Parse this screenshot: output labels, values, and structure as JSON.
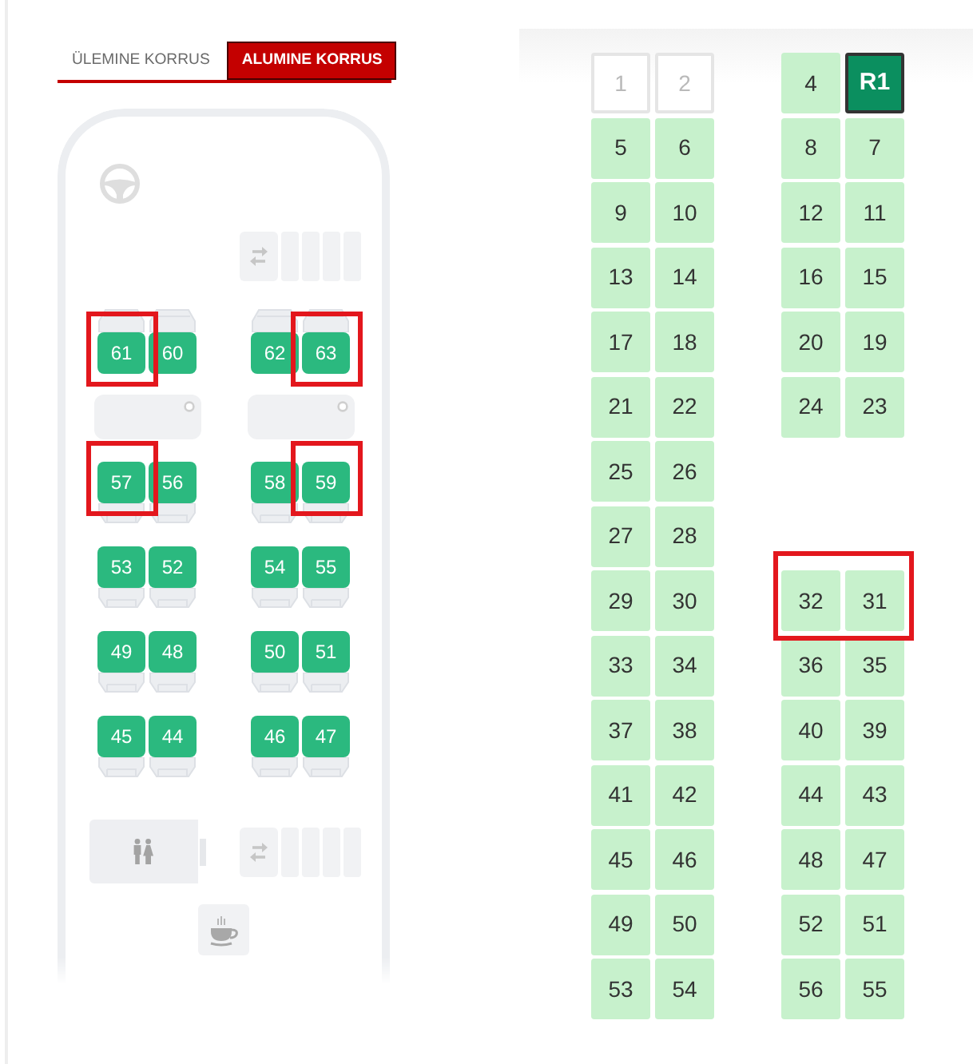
{
  "floor_tabs": [
    {
      "label": "ÜLEMINE KORRUS",
      "selected": false
    },
    {
      "label": "ALUMINE KORRUS",
      "selected": true
    }
  ],
  "bus_layout": [
    {
      "kind": "driver"
    },
    {
      "kind": "stairs"
    },
    {
      "kind": "seats",
      "back_above": true,
      "left": [
        {
          "label": "61",
          "highlighted": true
        },
        {
          "label": "60",
          "highlighted": false
        }
      ],
      "right": [
        {
          "label": "62",
          "highlighted": false
        },
        {
          "label": "63",
          "highlighted": true
        }
      ]
    },
    {
      "kind": "tables"
    },
    {
      "kind": "seats",
      "back_above": false,
      "left": [
        {
          "label": "57",
          "highlighted": true
        },
        {
          "label": "56",
          "highlighted": false
        }
      ],
      "right": [
        {
          "label": "58",
          "highlighted": false
        },
        {
          "label": "59",
          "highlighted": true
        }
      ]
    },
    {
      "kind": "seats",
      "back_above": false,
      "left": [
        {
          "label": "53",
          "highlighted": false
        },
        {
          "label": "52",
          "highlighted": false
        }
      ],
      "right": [
        {
          "label": "54",
          "highlighted": false
        },
        {
          "label": "55",
          "highlighted": false
        }
      ]
    },
    {
      "kind": "seats",
      "back_above": false,
      "left": [
        {
          "label": "49",
          "highlighted": false
        },
        {
          "label": "48",
          "highlighted": false
        }
      ],
      "right": [
        {
          "label": "50",
          "highlighted": false
        },
        {
          "label": "51",
          "highlighted": false
        }
      ]
    },
    {
      "kind": "seats",
      "back_above": false,
      "left": [
        {
          "label": "45",
          "highlighted": false
        },
        {
          "label": "44",
          "highlighted": false
        }
      ],
      "right": [
        {
          "label": "46",
          "highlighted": false
        },
        {
          "label": "47",
          "highlighted": false
        }
      ]
    },
    {
      "kind": "restroom_stairs"
    },
    {
      "kind": "cafe"
    }
  ],
  "seat_grid": {
    "rows": [
      {
        "left": {
          "highlighted": false,
          "seats": [
            {
              "label": "1",
              "available": false,
              "selected": false
            },
            {
              "label": "2",
              "available": false,
              "selected": false
            }
          ]
        },
        "right": {
          "highlighted": false,
          "seats": [
            {
              "label": "4",
              "available": true,
              "selected": false
            },
            {
              "label": "R1",
              "available": true,
              "selected": true
            }
          ]
        }
      },
      {
        "left": {
          "highlighted": false,
          "seats": [
            {
              "label": "5",
              "available": true,
              "selected": false
            },
            {
              "label": "6",
              "available": true,
              "selected": false
            }
          ]
        },
        "right": {
          "highlighted": false,
          "seats": [
            {
              "label": "8",
              "available": true,
              "selected": false
            },
            {
              "label": "7",
              "available": true,
              "selected": false
            }
          ]
        }
      },
      {
        "left": {
          "highlighted": false,
          "seats": [
            {
              "label": "9",
              "available": true,
              "selected": false
            },
            {
              "label": "10",
              "available": true,
              "selected": false
            }
          ]
        },
        "right": {
          "highlighted": false,
          "seats": [
            {
              "label": "12",
              "available": true,
              "selected": false
            },
            {
              "label": "11",
              "available": true,
              "selected": false
            }
          ]
        }
      },
      {
        "left": {
          "highlighted": false,
          "seats": [
            {
              "label": "13",
              "available": true,
              "selected": false
            },
            {
              "label": "14",
              "available": true,
              "selected": false
            }
          ]
        },
        "right": {
          "highlighted": false,
          "seats": [
            {
              "label": "16",
              "available": true,
              "selected": false
            },
            {
              "label": "15",
              "available": true,
              "selected": false
            }
          ]
        }
      },
      {
        "left": {
          "highlighted": false,
          "seats": [
            {
              "label": "17",
              "available": true,
              "selected": false
            },
            {
              "label": "18",
              "available": true,
              "selected": false
            }
          ]
        },
        "right": {
          "highlighted": false,
          "seats": [
            {
              "label": "20",
              "available": true,
              "selected": false
            },
            {
              "label": "19",
              "available": true,
              "selected": false
            }
          ]
        }
      },
      {
        "left": {
          "highlighted": false,
          "seats": [
            {
              "label": "21",
              "available": true,
              "selected": false
            },
            {
              "label": "22",
              "available": true,
              "selected": false
            }
          ]
        },
        "right": {
          "highlighted": false,
          "seats": [
            {
              "label": "24",
              "available": true,
              "selected": false
            },
            {
              "label": "23",
              "available": true,
              "selected": false
            }
          ]
        }
      },
      {
        "left": {
          "highlighted": false,
          "seats": [
            {
              "label": "25",
              "available": true,
              "selected": false
            },
            {
              "label": "26",
              "available": true,
              "selected": false
            }
          ]
        }
      },
      {
        "left": {
          "highlighted": false,
          "seats": [
            {
              "label": "27",
              "available": true,
              "selected": false
            },
            {
              "label": "28",
              "available": true,
              "selected": false
            }
          ]
        }
      },
      {
        "left": {
          "highlighted": false,
          "seats": [
            {
              "label": "29",
              "available": true,
              "selected": false
            },
            {
              "label": "30",
              "available": true,
              "selected": false
            }
          ]
        },
        "right": {
          "highlighted": true,
          "seats": [
            {
              "label": "32",
              "available": true,
              "selected": false
            },
            {
              "label": "31",
              "available": true,
              "selected": false
            }
          ]
        }
      },
      {
        "left": {
          "highlighted": false,
          "seats": [
            {
              "label": "33",
              "available": true,
              "selected": false
            },
            {
              "label": "34",
              "available": true,
              "selected": false
            }
          ]
        },
        "right": {
          "highlighted": false,
          "seats": [
            {
              "label": "36",
              "available": true,
              "selected": false
            },
            {
              "label": "35",
              "available": true,
              "selected": false
            }
          ]
        }
      },
      {
        "left": {
          "highlighted": false,
          "seats": [
            {
              "label": "37",
              "available": true,
              "selected": false
            },
            {
              "label": "38",
              "available": true,
              "selected": false
            }
          ]
        },
        "right": {
          "highlighted": false,
          "seats": [
            {
              "label": "40",
              "available": true,
              "selected": false
            },
            {
              "label": "39",
              "available": true,
              "selected": false
            }
          ]
        }
      },
      {
        "left": {
          "highlighted": false,
          "seats": [
            {
              "label": "41",
              "available": true,
              "selected": false
            },
            {
              "label": "42",
              "available": true,
              "selected": false
            }
          ]
        },
        "right": {
          "highlighted": false,
          "seats": [
            {
              "label": "44",
              "available": true,
              "selected": false
            },
            {
              "label": "43",
              "available": true,
              "selected": false
            }
          ]
        }
      },
      {
        "left": {
          "highlighted": false,
          "seats": [
            {
              "label": "45",
              "available": true,
              "selected": false
            },
            {
              "label": "46",
              "available": true,
              "selected": false
            }
          ]
        },
        "right": {
          "highlighted": false,
          "seats": [
            {
              "label": "48",
              "available": true,
              "selected": false
            },
            {
              "label": "47",
              "available": true,
              "selected": false
            }
          ]
        }
      },
      {
        "left": {
          "highlighted": false,
          "seats": [
            {
              "label": "49",
              "available": true,
              "selected": false
            },
            {
              "label": "50",
              "available": true,
              "selected": false
            }
          ]
        },
        "right": {
          "highlighted": false,
          "seats": [
            {
              "label": "52",
              "available": true,
              "selected": false
            },
            {
              "label": "51",
              "available": true,
              "selected": false
            }
          ]
        }
      },
      {
        "left": {
          "highlighted": false,
          "seats": [
            {
              "label": "53",
              "available": true,
              "selected": false
            },
            {
              "label": "54",
              "available": true,
              "selected": false
            }
          ]
        },
        "right": {
          "highlighted": false,
          "seats": [
            {
              "label": "56",
              "available": true,
              "selected": false
            },
            {
              "label": "55",
              "available": true,
              "selected": false
            }
          ]
        }
      }
    ]
  }
}
